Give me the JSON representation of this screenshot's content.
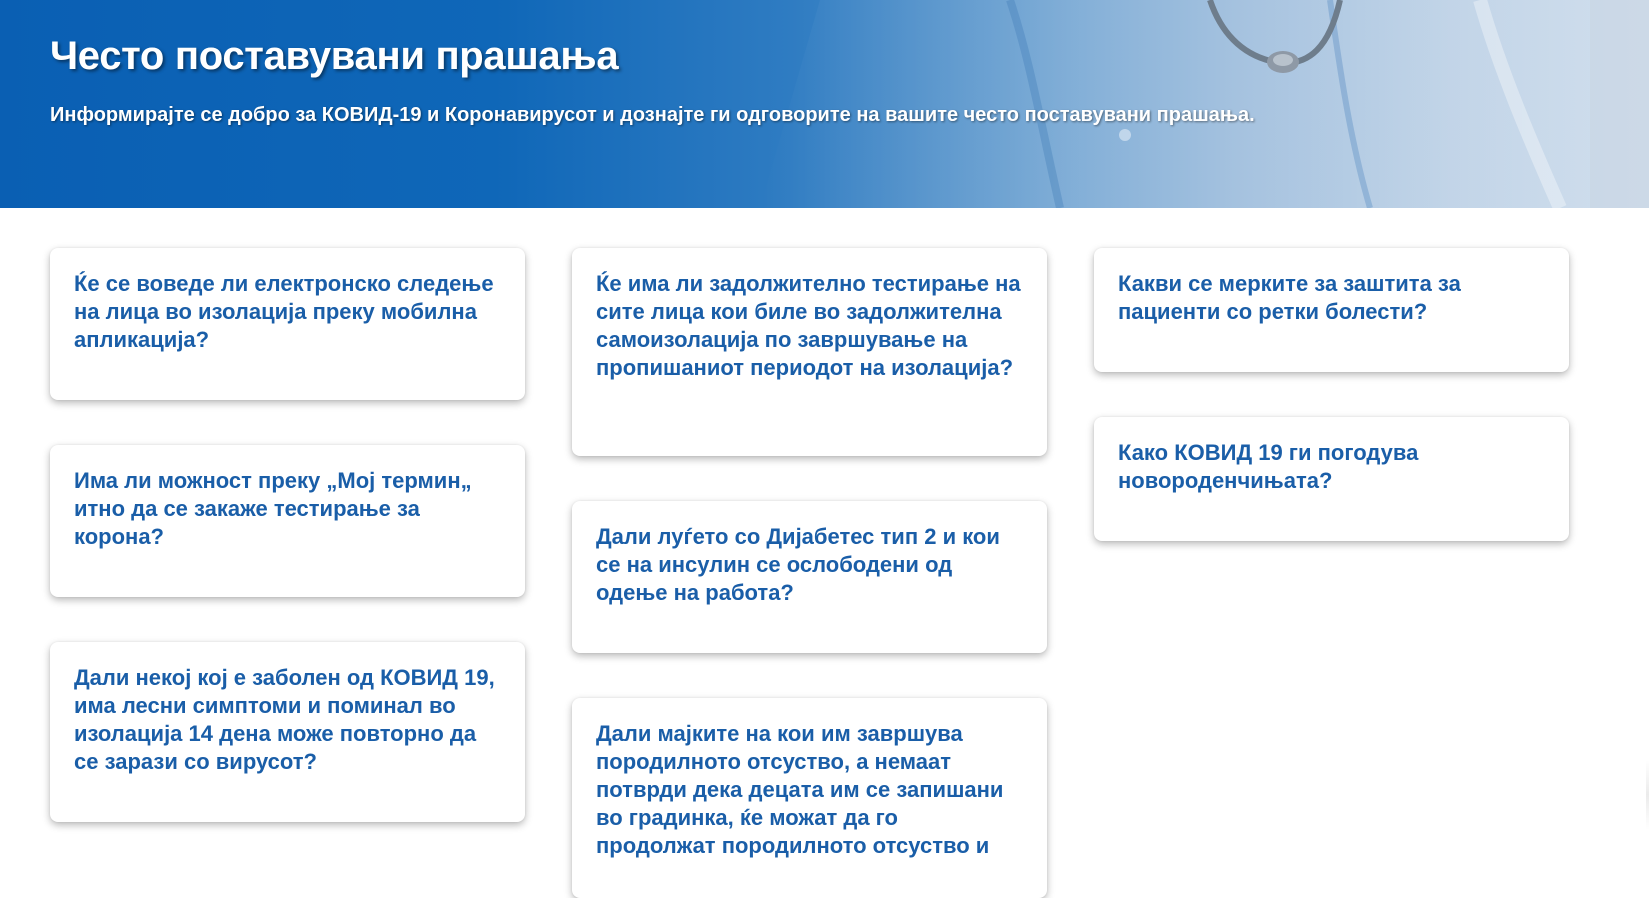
{
  "header": {
    "title": "Често поставувани прашања",
    "subtitle": "Информирајте се добро за КОВИД-19 и Коронавирусот и дознајте ги одговорите на вашите често поставувани прашања."
  },
  "faq": {
    "column1": [
      {
        "question": "Ќе се воведе ли електронско следење на лица во изолација преку мобилна апликација?"
      },
      {
        "question": "Има ли можност преку „Мој термин„ итно да се закаже тестирање за корона?"
      },
      {
        "question": "Дали некој кој е заболен од КОВИД 19, има лесни симптоми и поминал во изолација 14 дена може повторно да се зарази со вирусот?"
      }
    ],
    "column2": [
      {
        "question": "Ќе има ли задолжително тестирање на сите лица кои биле во задолжителна самоизолација по завршување на пропишаниот периодот на изолација?"
      },
      {
        "question": "Дали луѓето со Дијабетес тип 2 и кои се на инсулин се ослободени од одење на работа?"
      },
      {
        "question": "Дали мајките на кои им завршува породилното отсуство, а немаат потврди дека децата им се запишани во градинка, ќе можат да го продолжат породилното отсуство и"
      }
    ],
    "column3": [
      {
        "question": "Какви се мерките за заштита за пациенти со ретки болести?"
      },
      {
        "question": "Како КОВИД 19 ги погодува новороденчињата?"
      }
    ]
  }
}
